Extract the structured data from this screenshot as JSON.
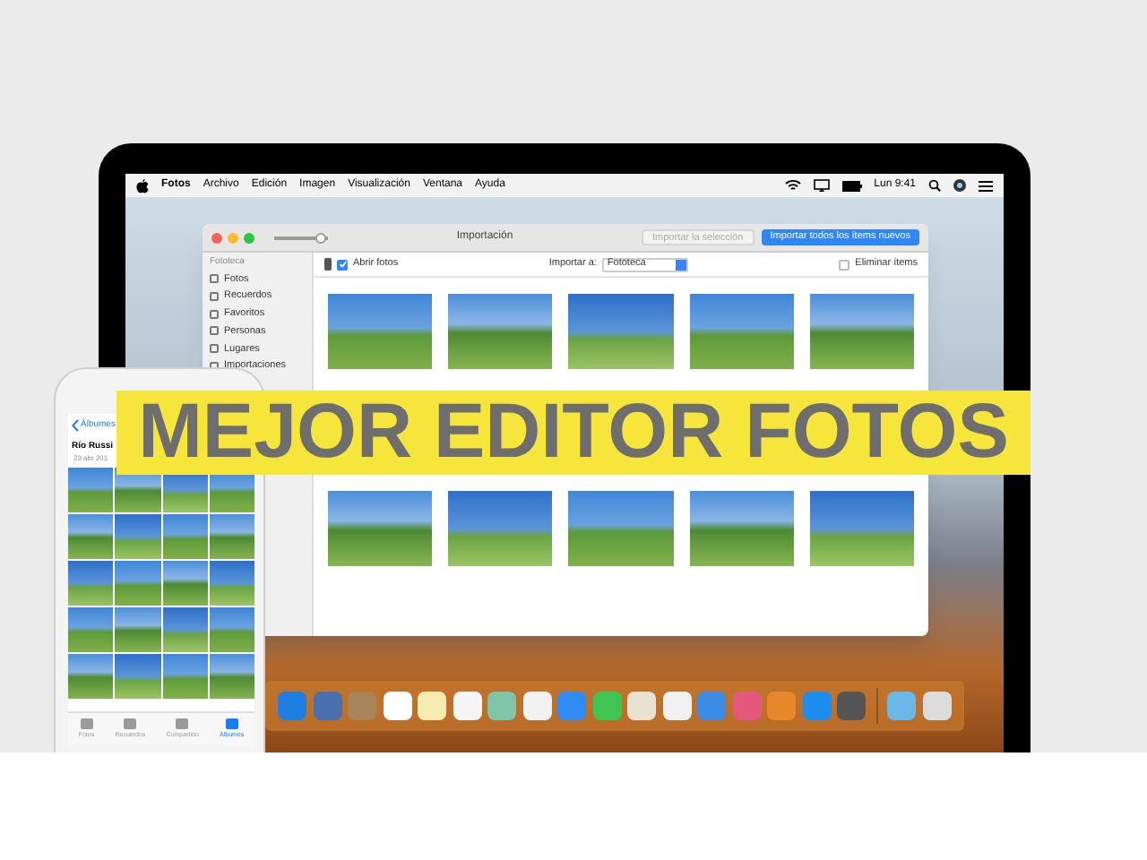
{
  "menu_bar": {
    "app_menu": "Fotos",
    "menus": [
      "Archivo",
      "Edición",
      "Imagen",
      "Visualización",
      "Ventana",
      "Ayuda"
    ],
    "clock": "Lun 9:41"
  },
  "window": {
    "title": "Importación",
    "zoom_slider": {
      "level": 0.95
    },
    "buttons": [
      {
        "label": "Importar la selección",
        "disabled": true
      },
      {
        "label": "Importar todos los ítems nuevos",
        "disabled": false
      }
    ],
    "toolbar": {
      "open_photos": {
        "label": "Abrir fotos",
        "checked": true
      },
      "import_to_label": "Importar a:",
      "destination": "Fototeca",
      "delete_items": {
        "label": "Eliminar ítems",
        "checked": false
      }
    },
    "sidebar": {
      "header": "Fototeca",
      "items": [
        {
          "label": "Fotos"
        },
        {
          "label": "Recuerdos"
        },
        {
          "label": "Favoritos"
        },
        {
          "label": "Personas"
        },
        {
          "label": "Lugares"
        },
        {
          "label": "Importaciones"
        }
      ]
    }
  },
  "banner": {
    "text": "MEJOR EDITOR FOTOS"
  },
  "phone": {
    "back": "Álbumes",
    "album_title": "Río Russi",
    "date": "23 abr 201",
    "tabs": [
      {
        "label": "Fotos",
        "selected": false
      },
      {
        "label": "Recuerdos",
        "selected": false
      },
      {
        "label": "Compartido",
        "selected": false
      },
      {
        "label": "Álbumes",
        "selected": true
      }
    ]
  }
}
